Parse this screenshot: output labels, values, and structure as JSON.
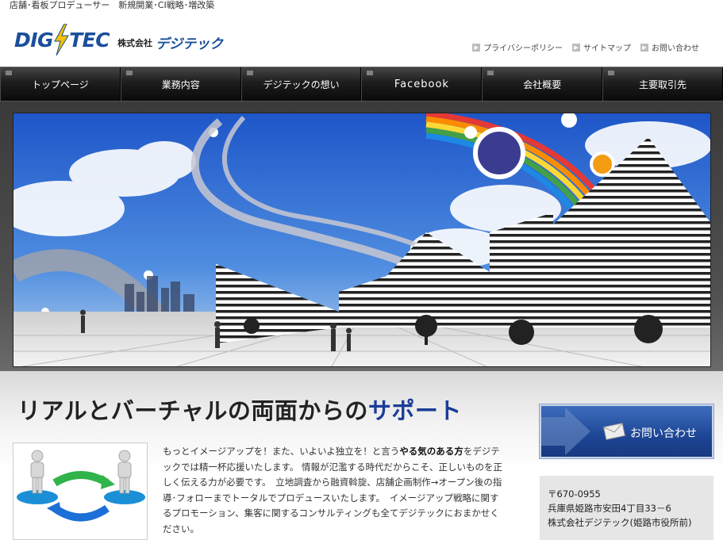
{
  "header": {
    "tagline": "店舗･看板プロデューサー　新規開業･CI戦略･増改築",
    "logo": {
      "word_left": "DIG",
      "word_right": "TEC",
      "kaisha": "株式会社",
      "kana": "デジテック"
    },
    "util_links": [
      {
        "label": "プライバシーポリシー"
      },
      {
        "label": "サイトマップ"
      },
      {
        "label": "お問い合わせ"
      }
    ]
  },
  "nav": {
    "items": [
      {
        "label": "トップページ"
      },
      {
        "label": "業務内容"
      },
      {
        "label": "デジテックの想い"
      },
      {
        "label": "Facebook"
      },
      {
        "label": "会社概要"
      },
      {
        "label": "主要取引先"
      }
    ]
  },
  "main": {
    "headline": {
      "prefix": "リアルとバーチャルの両面からの",
      "accent": "サポート"
    },
    "body": {
      "part1": "もっとイメージアップを！また、いよいよ独立を！と言う",
      "bold": "やる気のある方",
      "part2": "をデジテックでは精一杯応援いたします。 情報が氾濫する時代だからこそ、正しいものを正しく伝える力が必要です。　立地調査から融資斡旋、店舗企画制作→オープン後の指導･フォローまでトータルでプロデュースいたします。　イメージアップ戦略に関するプロモーション、集客に関するコンサルティングも全てデジテックにおまかせください。"
    }
  },
  "sidebar": {
    "contact_button": "お問い合わせ",
    "address": {
      "postal": "〒670-0955",
      "line1": "兵庫県姫路市安田4丁目33－6",
      "line2": "株式会社デジテック(姫路市役所前)"
    }
  },
  "colors": {
    "brand_blue": "#1a4f9c",
    "accent_blue": "#1b3c97",
    "nav_bg": "#1d1d1d"
  }
}
